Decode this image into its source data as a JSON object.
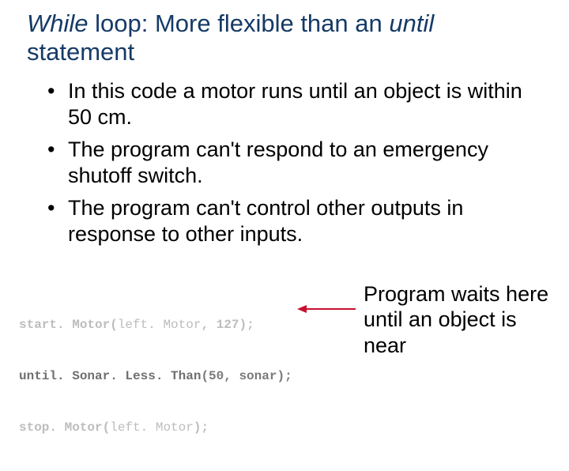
{
  "title": {
    "italic1": "While",
    "seg1": " loop: More flexible than an ",
    "italic2": "until",
    "seg2": " statement"
  },
  "bullets": [
    "In this code a motor runs until an object is within 50 cm.",
    "The program can't respond to an emergency shutoff switch.",
    "The program can't control other outputs in response to other inputs."
  ],
  "code": {
    "line1": {
      "fn": "start. Motor",
      "open": "(",
      "arg1": "left. Motor",
      "comma": ", ",
      "arg2": "127",
      "close": ");"
    },
    "line2": {
      "fn": "until. Sonar. Less. Than",
      "open": "(",
      "arg1": "50",
      "comma": ", ",
      "arg2": "sonar",
      "close": ");"
    },
    "line3": {
      "fn": "stop. Motor",
      "open": "(",
      "arg1": "left. Motor",
      "close": ");"
    }
  },
  "annotation": "Program waits here until an object is near",
  "arrow_color": "#c8102e"
}
